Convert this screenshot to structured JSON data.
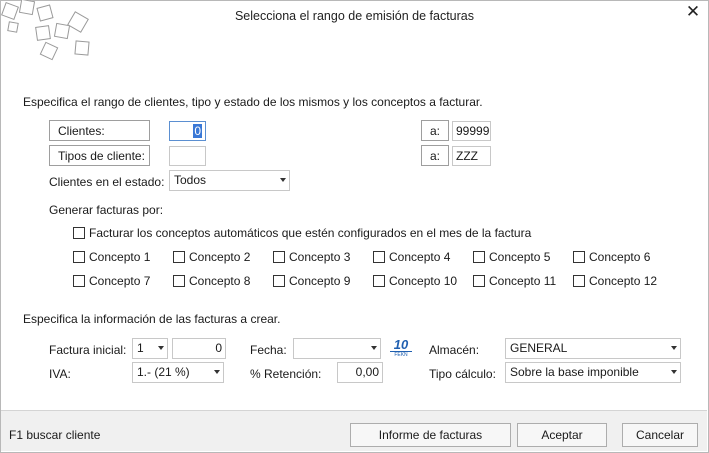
{
  "dialog": {
    "title": "Selecciona el rango de emisión de facturas",
    "close_glyph": "✕"
  },
  "range": {
    "heading": "Especifica el rango de clientes, tipo y estado de los mismos y los conceptos a facturar.",
    "clientes_label": "Clientes:",
    "clientes_from": "0",
    "clientes_a_label": "a:",
    "clientes_to": "99999",
    "tipos_label": "Tipos de cliente:",
    "tipos_from": "",
    "tipos_a_label": "a:",
    "tipos_to": "ZZZ",
    "estado_label": "Clientes en el estado:",
    "estado_value": "Todos"
  },
  "generar": {
    "label": "Generar facturas por:",
    "auto_label": "Facturar los conceptos automáticos que estén configurados en el mes de la factura",
    "conceptos": [
      "Concepto 1",
      "Concepto 2",
      "Concepto 3",
      "Concepto 4",
      "Concepto 5",
      "Concepto 6",
      "Concepto 7",
      "Concepto 8",
      "Concepto 9",
      "Concepto 10",
      "Concepto 11",
      "Concepto 12"
    ]
  },
  "info": {
    "heading": "Especifica la información de las facturas a crear.",
    "factura_label": "Factura inicial:",
    "serie_value": "1",
    "factura_value": "0",
    "fecha_label": "Fecha:",
    "fecha_value": "",
    "almacen_label": "Almacén:",
    "almacen_value": "GENERAL",
    "iva_label": "IVA:",
    "iva_value": "1.- (21 %)",
    "retencion_label": "% Retención:",
    "retencion_value": "0,00",
    "tipo_calculo_label": "Tipo cálculo:",
    "tipo_calculo_value": "Sobre la base imponible",
    "calendar_icon_text": "10",
    "calendar_icon_subtext": "FEKN"
  },
  "footer": {
    "hint": "F1 buscar cliente",
    "informe_button": "Informe de facturas",
    "aceptar_button": "Aceptar",
    "cancelar_button": "Cancelar"
  },
  "colors": {
    "selection": "#3a78d6",
    "footer_bg": "#f0f0f0",
    "calendar_icon": "#1f5fb0"
  }
}
